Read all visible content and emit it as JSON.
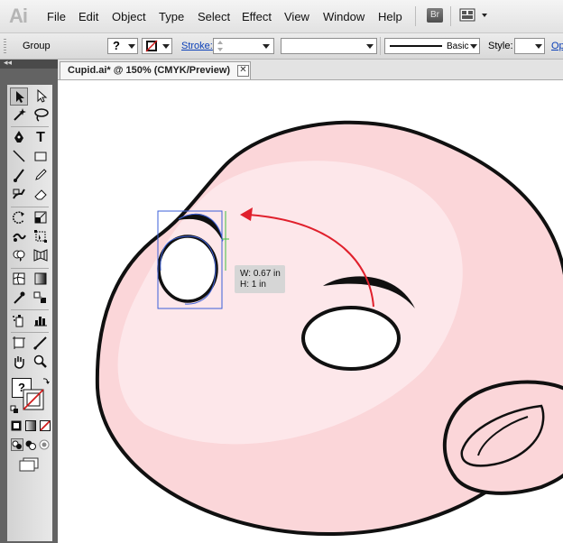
{
  "app": {
    "logo": "Ai"
  },
  "menu": [
    "File",
    "Edit",
    "Object",
    "Type",
    "Select",
    "Effect",
    "View",
    "Window",
    "Help"
  ],
  "menu_extras": {
    "bridge": "Br"
  },
  "controlbar": {
    "selection": "Group",
    "fill_value": "?",
    "stroke_label": "Stroke:",
    "brush_label": "Basic",
    "style_label": "Style:",
    "opacity_label": "Op"
  },
  "document": {
    "tab_title": "Cupid.ai* @ 150% (CMYK/Preview)",
    "close": "✕"
  },
  "tooltip": {
    "width": "W: 0.67 in",
    "height": "H: 1 in"
  },
  "tools": {
    "fill_stroke_fill_label": "?",
    "icons": [
      "selection-icon",
      "direct-selection-icon",
      "magic-wand-icon",
      "lasso-icon",
      "pen-icon",
      "type-icon",
      "line-icon",
      "rectangle-icon",
      "paintbrush-icon",
      "pencil-icon",
      "blob-brush-icon",
      "eraser-icon",
      "rotate-icon",
      "scale-icon",
      "warp-icon",
      "free-transform-icon",
      "shape-builder-icon",
      "perspective-grid-icon",
      "mesh-icon",
      "gradient-icon",
      "eyedropper-icon",
      "blend-icon",
      "symbol-sprayer-icon",
      "column-graph-icon",
      "artboard-icon",
      "slice-icon",
      "hand-icon",
      "zoom-icon"
    ]
  },
  "colors": {
    "face_fill": "#fbd7da",
    "face_highlight": "#fde6e8",
    "outline": "#111111",
    "arrow": "#e0202c",
    "selection": "#3b5fd8",
    "guide": "#3fbf3f"
  }
}
